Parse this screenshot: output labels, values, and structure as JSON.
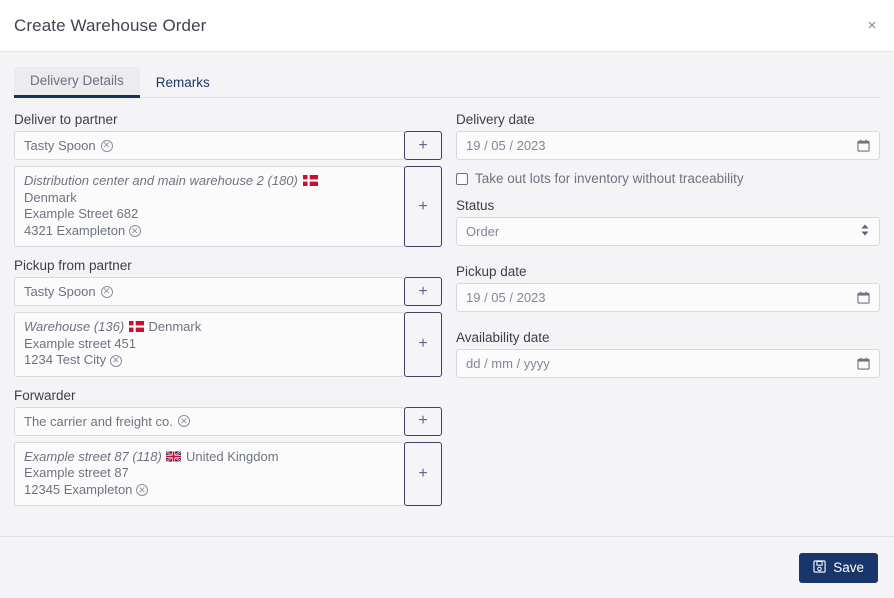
{
  "dialog": {
    "title": "Create Warehouse Order",
    "close_label": "×"
  },
  "tabs": [
    {
      "label": "Delivery Details",
      "active": true
    },
    {
      "label": "Remarks",
      "active": false
    }
  ],
  "left_column": {
    "deliver_to_partner": {
      "label": "Deliver to partner",
      "partner_value": "Tasty Spoon",
      "add_button_label": "+",
      "address": {
        "title": "Distribution center and main warehouse 2 (180)",
        "flag": "dk-flag-icon",
        "country": "Denmark",
        "street": "Example Street 682",
        "city": "4321 Exampleton"
      },
      "address_add_button_label": "+"
    },
    "pickup_from_partner": {
      "label": "Pickup from partner",
      "partner_value": "Tasty Spoon",
      "add_button_label": "+",
      "address": {
        "title": "Warehouse (136)",
        "flag": "dk-flag-icon",
        "country": "Denmark",
        "street": "Example street 451",
        "city": "1234 Test City"
      },
      "address_add_button_label": "+"
    },
    "forwarder": {
      "label": "Forwarder",
      "partner_value": "The carrier and freight co.",
      "add_button_label": "+",
      "address": {
        "title": "Example street 87 (118)",
        "flag": "gb-flag-icon",
        "country": "United Kingdom",
        "street": "Example street 87",
        "city": "12345 Exampleton"
      },
      "address_add_button_label": "+"
    }
  },
  "right_column": {
    "delivery_date": {
      "label": "Delivery date",
      "value": "19 / 05 / 2023"
    },
    "traceability_checkbox": {
      "label": "Take out lots for inventory without traceability",
      "checked": false
    },
    "status": {
      "label": "Status",
      "value": "Order",
      "options": [
        "Order"
      ]
    },
    "pickup_date": {
      "label": "Pickup date",
      "value": "19 / 05 / 2023"
    },
    "availability_date": {
      "label": "Availability date",
      "value": "dd / mm / yyyy"
    }
  },
  "footer": {
    "save_label": "Save",
    "save_icon": "floppy-disk-icon"
  },
  "colors": {
    "accent": "#19366b",
    "plus_border": "#4b3a63",
    "page_bg": "#f4f4f6",
    "flag_red": "#c8102e",
    "flag_blue": "#012169"
  }
}
